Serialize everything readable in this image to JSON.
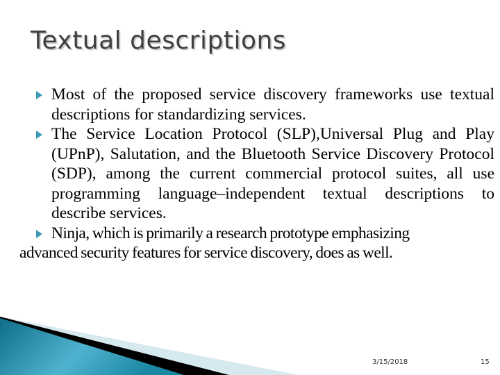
{
  "slide": {
    "title": "Textual descriptions",
    "bullets": [
      {
        "text": "Most of the proposed service discovery frameworks use textual descriptions for standardizing services."
      },
      {
        "text": "The Service Location Protocol (SLP),Universal Plug and Play (UPnP), Salutation, and the Bluetooth Service Discovery Protocol (SDP), among the current commercial protocol suites, all use programming language–independent textual descriptions to describe services."
      },
      {
        "line1": "Ninja, which is primarily a research prototype emphasizing",
        "line2": "advanced security features for service discovery, does as well."
      }
    ],
    "footer": {
      "date": "3/15/2018",
      "page_number": "15"
    },
    "colors": {
      "accent": "#3a9ab6",
      "title": "#404040",
      "deco_dark": "#0e6d86",
      "deco_light": "#d6e9ef"
    }
  }
}
